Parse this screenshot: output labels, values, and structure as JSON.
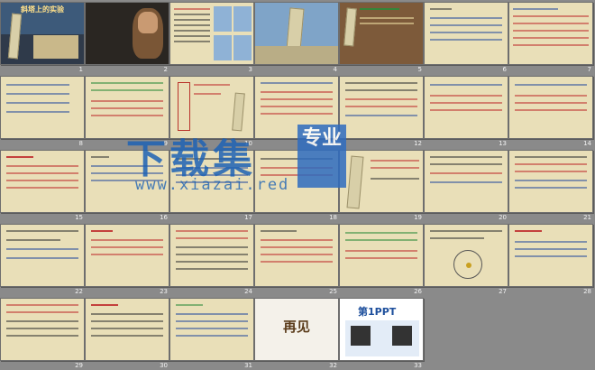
{
  "window": {
    "title": ""
  },
  "slides": [
    {
      "num": "1"
    },
    {
      "num": "2"
    },
    {
      "num": "3"
    },
    {
      "num": "4"
    },
    {
      "num": "5"
    },
    {
      "num": "6"
    },
    {
      "num": "7"
    },
    {
      "num": "8"
    },
    {
      "num": "9"
    },
    {
      "num": "10"
    },
    {
      "num": "11"
    },
    {
      "num": "12"
    },
    {
      "num": "13"
    },
    {
      "num": "14"
    },
    {
      "num": "15"
    },
    {
      "num": "16"
    },
    {
      "num": "17"
    },
    {
      "num": "18"
    },
    {
      "num": "19"
    },
    {
      "num": "20"
    },
    {
      "num": "21"
    },
    {
      "num": "22"
    },
    {
      "num": "23"
    },
    {
      "num": "24"
    },
    {
      "num": "25"
    },
    {
      "num": "26"
    },
    {
      "num": "27"
    },
    {
      "num": "28"
    },
    {
      "num": "29"
    },
    {
      "num": "30"
    },
    {
      "num": "31"
    },
    {
      "num": "32"
    },
    {
      "num": "33"
    }
  ],
  "slide_text": {
    "s1_title": "斜塔上的实验",
    "s32_text": "再见",
    "s33_logo": "第1PPT"
  },
  "watermark": {
    "main": "下载集",
    "badge": "专业",
    "url": "www.xiazai.red"
  }
}
